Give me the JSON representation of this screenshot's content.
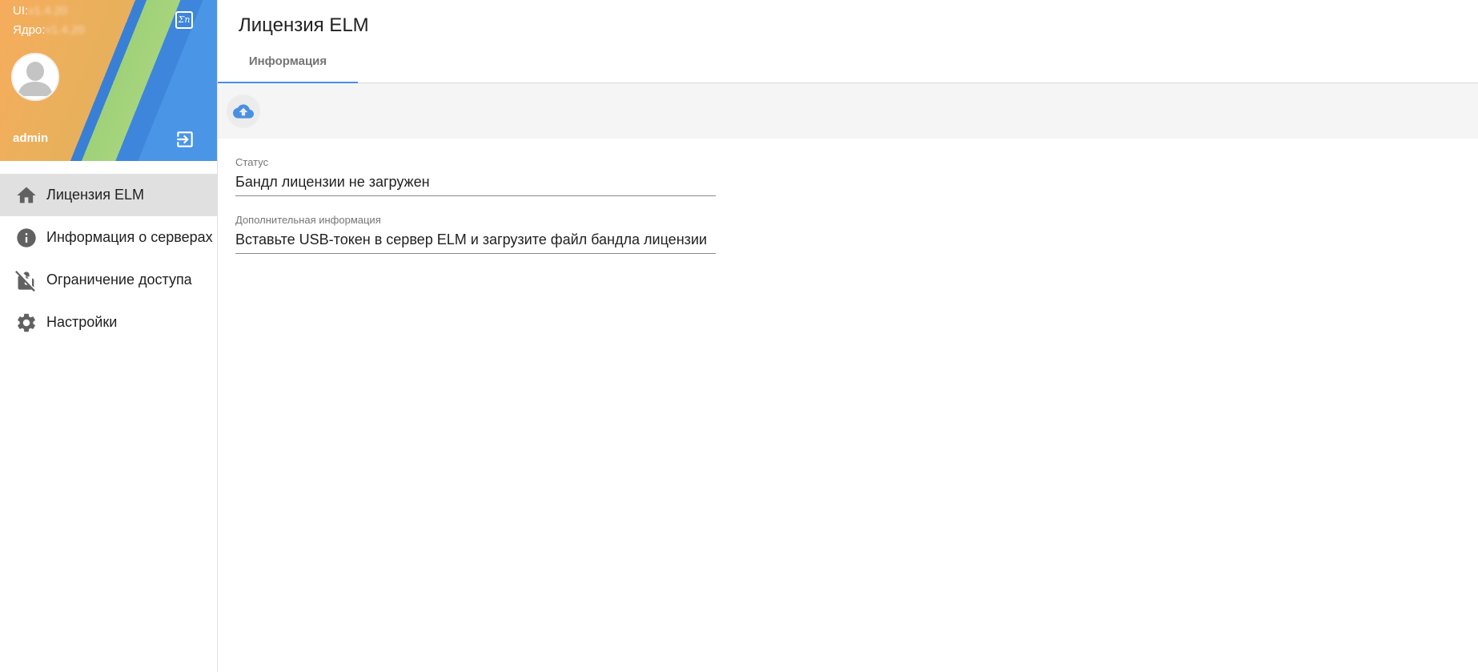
{
  "sidebar": {
    "version": {
      "ui_label": "UI:",
      "ui_value": "v1.4.20",
      "core_label": "Ядро:",
      "core_value": "v1.4.20"
    },
    "language_icon": "language-icon",
    "username": "admin",
    "logout_icon": "logout-icon",
    "items": [
      {
        "label": "Лицензия ELM",
        "icon": "home-icon",
        "active": true
      },
      {
        "label": "Информация о серверах",
        "icon": "info-icon",
        "active": false
      },
      {
        "label": "Ограничение доступа",
        "icon": "lock-off-icon",
        "active": false
      },
      {
        "label": "Настройки",
        "icon": "gear-icon",
        "active": false
      }
    ]
  },
  "main": {
    "title": "Лицензия ELM",
    "tabs": [
      {
        "label": "Информация",
        "active": true
      }
    ],
    "toolbar": {
      "upload_icon": "cloud-upload-icon"
    },
    "fields": {
      "status": {
        "label": "Статус",
        "value": "Бандл лицензии не загружен"
      },
      "info": {
        "label": "Дополнительная информация",
        "value": "Вставьте USB-токен в сервер ELM и загрузите файл бандла лицензии"
      }
    }
  },
  "colors": {
    "accent": "#4a90e2",
    "active_nav_bg": "#e0e0e0",
    "toolbar_bg": "#f5f5f5",
    "icon_gray": "#616161"
  }
}
